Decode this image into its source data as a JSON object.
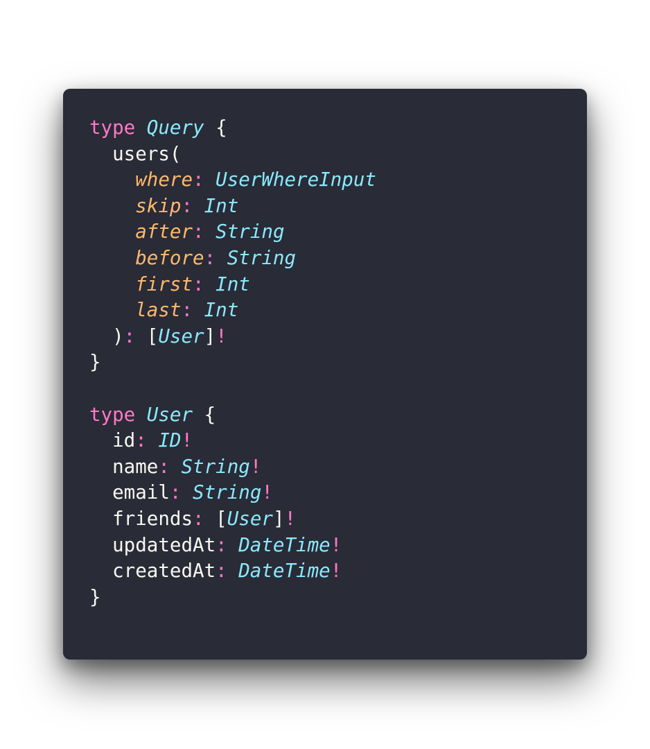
{
  "lines": [
    [
      {
        "t": "type",
        "c": "kw"
      },
      {
        "t": " ",
        "c": "plain"
      },
      {
        "t": "Query",
        "c": "tn"
      },
      {
        "t": " {",
        "c": "plain"
      }
    ],
    [
      {
        "t": "  users(",
        "c": "plain"
      }
    ],
    [
      {
        "t": "    ",
        "c": "plain"
      },
      {
        "t": "where",
        "c": "arg"
      },
      {
        "t": ":",
        "c": "punc"
      },
      {
        "t": " ",
        "c": "plain"
      },
      {
        "t": "UserWhereInput",
        "c": "tn"
      }
    ],
    [
      {
        "t": "    ",
        "c": "plain"
      },
      {
        "t": "skip",
        "c": "arg"
      },
      {
        "t": ":",
        "c": "punc"
      },
      {
        "t": " ",
        "c": "plain"
      },
      {
        "t": "Int",
        "c": "tn"
      }
    ],
    [
      {
        "t": "    ",
        "c": "plain"
      },
      {
        "t": "after",
        "c": "arg"
      },
      {
        "t": ":",
        "c": "punc"
      },
      {
        "t": " ",
        "c": "plain"
      },
      {
        "t": "String",
        "c": "tn"
      }
    ],
    [
      {
        "t": "    ",
        "c": "plain"
      },
      {
        "t": "before",
        "c": "arg"
      },
      {
        "t": ":",
        "c": "punc"
      },
      {
        "t": " ",
        "c": "plain"
      },
      {
        "t": "String",
        "c": "tn"
      }
    ],
    [
      {
        "t": "    ",
        "c": "plain"
      },
      {
        "t": "first",
        "c": "arg"
      },
      {
        "t": ":",
        "c": "punc"
      },
      {
        "t": " ",
        "c": "plain"
      },
      {
        "t": "Int",
        "c": "tn"
      }
    ],
    [
      {
        "t": "    ",
        "c": "plain"
      },
      {
        "t": "last",
        "c": "arg"
      },
      {
        "t": ":",
        "c": "punc"
      },
      {
        "t": " ",
        "c": "plain"
      },
      {
        "t": "Int",
        "c": "tn"
      }
    ],
    [
      {
        "t": "  )",
        "c": "plain"
      },
      {
        "t": ":",
        "c": "punc"
      },
      {
        "t": " [",
        "c": "plain"
      },
      {
        "t": "User",
        "c": "tn"
      },
      {
        "t": "]",
        "c": "plain"
      },
      {
        "t": "!",
        "c": "punc"
      }
    ],
    [
      {
        "t": "}",
        "c": "plain"
      }
    ],
    [
      {
        "t": "",
        "c": "plain"
      }
    ],
    [
      {
        "t": "type",
        "c": "kw"
      },
      {
        "t": " ",
        "c": "plain"
      },
      {
        "t": "User",
        "c": "tn"
      },
      {
        "t": " {",
        "c": "plain"
      }
    ],
    [
      {
        "t": "  id",
        "c": "plain"
      },
      {
        "t": ":",
        "c": "punc"
      },
      {
        "t": " ",
        "c": "plain"
      },
      {
        "t": "ID",
        "c": "tn"
      },
      {
        "t": "!",
        "c": "punc"
      }
    ],
    [
      {
        "t": "  name",
        "c": "plain"
      },
      {
        "t": ":",
        "c": "punc"
      },
      {
        "t": " ",
        "c": "plain"
      },
      {
        "t": "String",
        "c": "tn"
      },
      {
        "t": "!",
        "c": "punc"
      }
    ],
    [
      {
        "t": "  email",
        "c": "plain"
      },
      {
        "t": ":",
        "c": "punc"
      },
      {
        "t": " ",
        "c": "plain"
      },
      {
        "t": "String",
        "c": "tn"
      },
      {
        "t": "!",
        "c": "punc"
      }
    ],
    [
      {
        "t": "  friends",
        "c": "plain"
      },
      {
        "t": ":",
        "c": "punc"
      },
      {
        "t": " [",
        "c": "plain"
      },
      {
        "t": "User",
        "c": "tn"
      },
      {
        "t": "]",
        "c": "plain"
      },
      {
        "t": "!",
        "c": "punc"
      }
    ],
    [
      {
        "t": "  updatedAt",
        "c": "plain"
      },
      {
        "t": ":",
        "c": "punc"
      },
      {
        "t": " ",
        "c": "plain"
      },
      {
        "t": "DateTime",
        "c": "tn"
      },
      {
        "t": "!",
        "c": "punc"
      }
    ],
    [
      {
        "t": "  createdAt",
        "c": "plain"
      },
      {
        "t": ":",
        "c": "punc"
      },
      {
        "t": " ",
        "c": "plain"
      },
      {
        "t": "DateTime",
        "c": "tn"
      },
      {
        "t": "!",
        "c": "punc"
      }
    ],
    [
      {
        "t": "}",
        "c": "plain"
      }
    ]
  ],
  "colors": {
    "background": "#292b36",
    "keyword": "#ff79c6",
    "type_name": "#8be9fd",
    "argument": "#ffb86c",
    "text": "#f8f8f2"
  }
}
